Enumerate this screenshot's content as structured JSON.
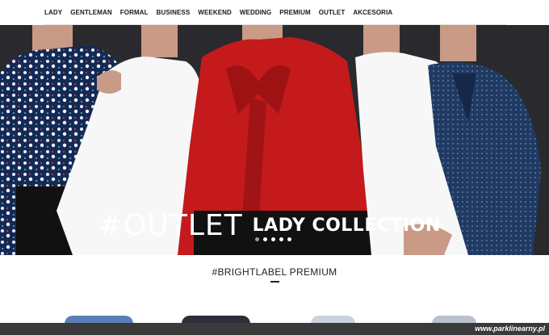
{
  "nav": {
    "items": [
      {
        "label": "LADY"
      },
      {
        "label": "GENTLEMAN"
      },
      {
        "label": "FORMAL"
      },
      {
        "label": "BUSINESS"
      },
      {
        "label": "WEEKEND"
      },
      {
        "label": "WEDDING"
      },
      {
        "label": "PREMIUM"
      },
      {
        "label": "OUTLET"
      },
      {
        "label": "AKCESORIA"
      }
    ]
  },
  "hero": {
    "hashtag": "#OUTLET",
    "subtitle": "LADY COLLECTION",
    "slide_count": 5,
    "active_slide": 1
  },
  "section": {
    "title": "#BRIGHTLABEL PREMIUM"
  },
  "watermark": {
    "text": "www.parklinearny.pl"
  },
  "colors": {
    "red_shirt": "#c41a1c",
    "navy_shirt": "#1f3a63",
    "white_shirt": "#f7f7f7",
    "backdrop": "#2a2a2e"
  }
}
